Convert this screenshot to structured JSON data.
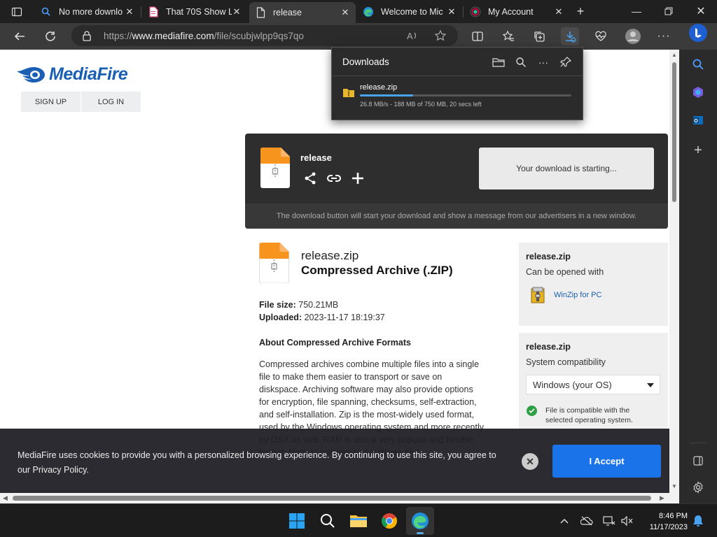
{
  "browser": {
    "tabs": [
      {
        "label": "No more downlo",
        "icon": "search-icon"
      },
      {
        "label": "That 70S Show L",
        "icon": "document-icon"
      },
      {
        "label": "release",
        "icon": "page-icon",
        "active": true
      },
      {
        "label": "Welcome to Mic",
        "icon": "edge-icon"
      },
      {
        "label": "My Account",
        "icon": "chrome-icon"
      }
    ],
    "url_prefix": "https://",
    "url_domain": "www.mediafire.com",
    "url_path": "/file/scubjwlpp9qs7qo"
  },
  "downloads_flyout": {
    "title": "Downloads",
    "item": {
      "name": "release.zip",
      "status": "26.8 MB/s - 188 MB of 750 MB, 20 secs left",
      "progress": 0.25
    }
  },
  "mediafire": {
    "logo": "MediaFire",
    "sign_up": "SIGN UP",
    "log_in": "LOG IN",
    "panel": {
      "file_name": "release",
      "download_status": "Your download is starting...",
      "note": "The download button will start your download and show a message from our advertisers in a new window."
    },
    "file": {
      "name": "release.zip",
      "type": "Compressed Archive (.ZIP)",
      "size_label": "File size:",
      "size": "750.21MB",
      "uploaded_label": "Uploaded:",
      "uploaded": "2023-11-17 18:19:37"
    },
    "about": {
      "heading": "About Compressed Archive Formats",
      "text": "Compressed archives combine multiple files into a single file to make them easier to transport or save on diskspace. Archiving software may also provide options for encryption, file spanning, checksums, self-extraction, and self-installation. Zip is the most-widely used format, used by the Windows operating system and more recently by OSX as well. RAR is also a very popular and flexible format. Normal compressed archives and"
    },
    "open_card": {
      "title": "release.zip",
      "subtitle": "Can be opened with",
      "app": "WinZip for PC"
    },
    "compat_card": {
      "title": "release.zip",
      "subtitle": "System compatibility",
      "os_selected": "Windows (your OS)",
      "compat_text": "File is compatible with the selected operating system."
    },
    "cookie": {
      "text": "MediaFire uses cookies to provide you with a personalized browsing experience. By continuing to use this site, you agree to our Privacy Policy.",
      "accept": "I Accept"
    }
  },
  "taskbar": {
    "time": "8:46 PM",
    "date": "11/17/2023"
  },
  "colors": {
    "accent": "#1a73e8",
    "brand": "#1a5fb4"
  }
}
